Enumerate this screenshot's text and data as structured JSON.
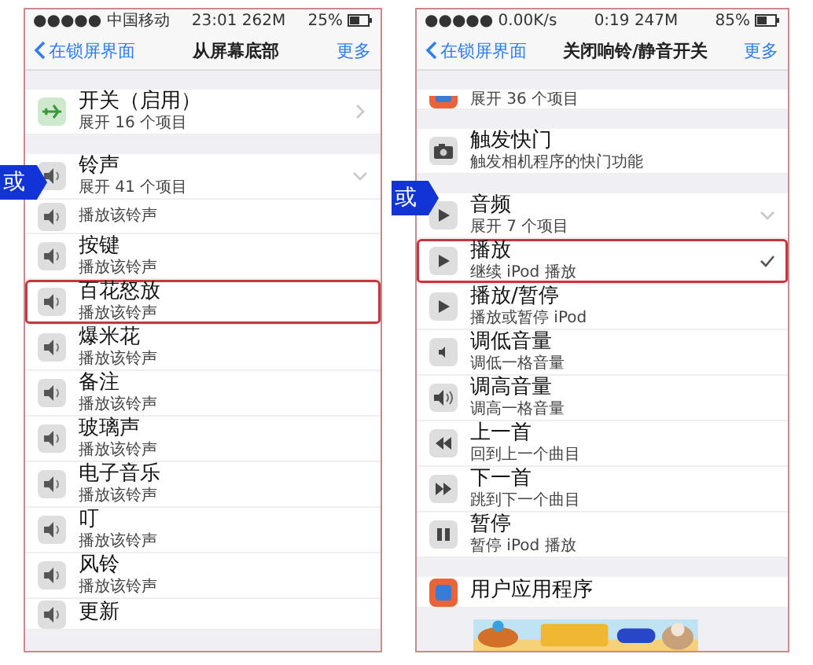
{
  "screens": [
    {
      "status_bar": {
        "carrier": "●●●●● 中国移动",
        "time": "23:01 262M",
        "battery": "25%"
      },
      "nav": {
        "back": "在锁屏界面",
        "title": "从屏幕底部",
        "action": "更多"
      },
      "callout": "或",
      "sections": [
        {
          "rows": [
            {
              "kind": "airplane",
              "title": "开关（启用）",
              "subtitle": "展开 16 个项目",
              "expanded": false,
              "highlighted": false
            }
          ]
        },
        {
          "rows": [
            {
              "kind": "speaker",
              "title": "铃声",
              "subtitle": "展开 41 个项目",
              "expanded": true,
              "highlighted": false
            },
            {
              "kind": "speaker",
              "subtitle": "播放该铃声",
              "selected": false,
              "highlighted": false
            },
            {
              "kind": "speaker",
              "title": "按键",
              "subtitle": "播放该铃声",
              "selected": false,
              "highlighted": false
            },
            {
              "kind": "speaker",
              "title": "百花怒放",
              "subtitle": "播放该铃声",
              "selected": false,
              "highlighted": true
            },
            {
              "kind": "speaker",
              "title": "爆米花",
              "subtitle": "播放该铃声",
              "selected": false,
              "highlighted": false
            },
            {
              "kind": "speaker",
              "title": "备注",
              "subtitle": "播放该铃声",
              "selected": false,
              "highlighted": false
            },
            {
              "kind": "speaker",
              "title": "玻璃声",
              "subtitle": "播放该铃声",
              "selected": false,
              "highlighted": false
            },
            {
              "kind": "speaker",
              "title": "电子音乐",
              "subtitle": "播放该铃声",
              "selected": false,
              "highlighted": false
            },
            {
              "kind": "speaker",
              "title": "叮",
              "subtitle": "播放该铃声",
              "selected": false,
              "highlighted": false
            },
            {
              "kind": "speaker",
              "title": "风铃",
              "subtitle": "播放该铃声",
              "selected": false,
              "highlighted": false
            },
            {
              "kind": "speaker",
              "title": "更新",
              "selected": false,
              "highlighted": false
            }
          ]
        }
      ]
    },
    {
      "status_bar": {
        "carrier": "●●●●● 0.00K/s",
        "time": "0:19 247M",
        "battery": "85%"
      },
      "nav": {
        "back": "在锁屏界面",
        "title": "关闭响铃/静音开关",
        "action": "更多"
      },
      "callout": "或",
      "sections": [
        {
          "rows": [
            {
              "kind": "cut",
              "subtitle": "展开 36 个项目",
              "selected": false,
              "highlighted": false
            }
          ]
        },
        {
          "rows": [
            {
              "kind": "camera",
              "title": "触发快门",
              "subtitle": "触发相机程序的快门功能",
              "selected": false,
              "highlighted": false
            }
          ]
        },
        {
          "rows": [
            {
              "kind": "play",
              "title": "音频",
              "subtitle": "展开 7 个项目",
              "expanded": true,
              "highlighted": false
            },
            {
              "kind": "play",
              "title": "播放",
              "subtitle": "继续 iPod 播放",
              "selected": true,
              "highlighted": true
            },
            {
              "kind": "play",
              "title": "播放/暂停",
              "subtitle": "播放或暂停 iPod",
              "selected": false,
              "highlighted": false
            },
            {
              "kind": "volume-down",
              "title": "调低音量",
              "subtitle": "调低一格音量",
              "selected": false,
              "highlighted": false
            },
            {
              "kind": "volume-up",
              "title": "调高音量",
              "subtitle": "调高一格音量",
              "selected": false,
              "highlighted": false
            },
            {
              "kind": "previous",
              "title": "上一首",
              "subtitle": "回到上一个曲目",
              "selected": false,
              "highlighted": false
            },
            {
              "kind": "next",
              "title": "下一首",
              "subtitle": "跳到下一个曲目",
              "selected": false,
              "highlighted": false
            },
            {
              "kind": "pause",
              "title": "暂停",
              "subtitle": "暂停 iPod 播放",
              "selected": false,
              "highlighted": false
            }
          ]
        },
        {
          "rows": [
            {
              "kind": "app",
              "title": "用户应用程序",
              "selected": false,
              "highlighted": false
            }
          ]
        }
      ]
    }
  ]
}
